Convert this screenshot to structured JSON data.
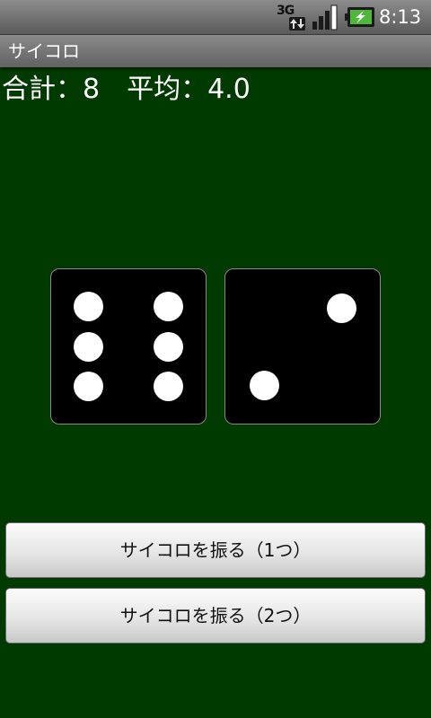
{
  "status_bar": {
    "network_type": "3G",
    "time": "8:13",
    "icons": [
      "3g-data-icon",
      "signal-strength-icon",
      "battery-charging-icon"
    ]
  },
  "app": {
    "title": "サイコロ"
  },
  "stats": {
    "total_label": "合計：8",
    "average_label": "平均：4.0"
  },
  "dice": {
    "values": [
      6,
      2
    ]
  },
  "buttons": {
    "roll_one": "サイコロを振る（1つ）",
    "roll_two": "サイコロを振る（2つ）"
  },
  "colors": {
    "background": "#003a00",
    "die": "#000000",
    "pip": "#ffffff",
    "text": "#ffffff"
  }
}
